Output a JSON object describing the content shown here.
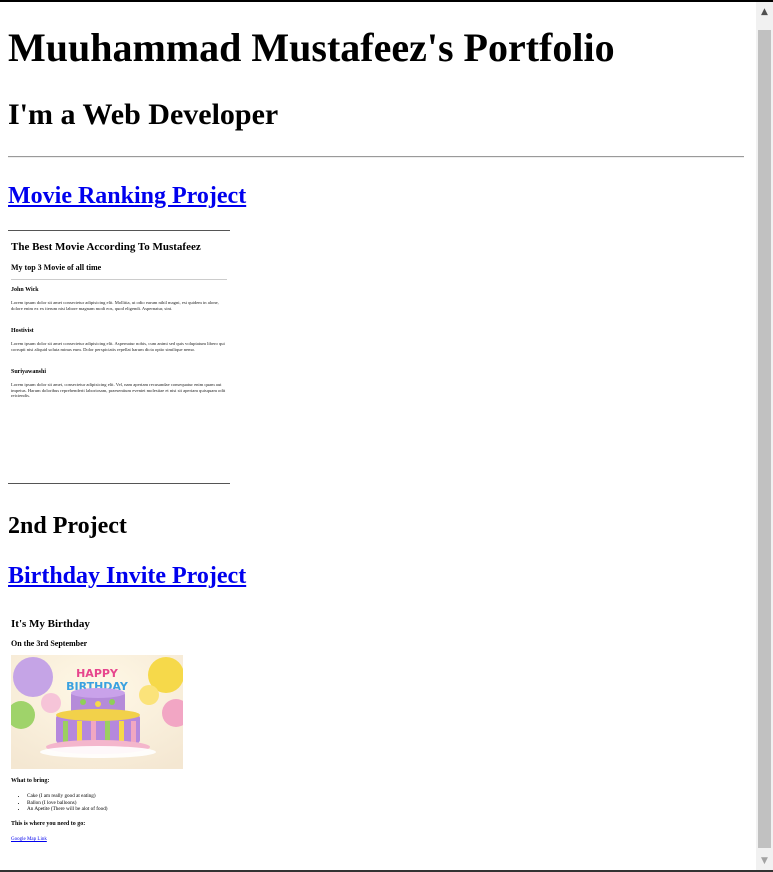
{
  "page": {
    "title": "Muuhammad Mustafeez's Portfolio",
    "subtitle": "I'm a Web Developer"
  },
  "projects": {
    "first_link": "Movie Ranking Project",
    "second_heading": "2nd Project",
    "second_link": "Birthday Invite Project"
  },
  "movie_frame": {
    "title": "The Best Movie According To Mustafeez",
    "subtitle": "My top 3 Movie of all time",
    "movies": [
      {
        "name": "John Wick",
        "text": "Lorem ipsum dolor sit amet consectetur adipisicing elit. Mollitia, ut odio earum nihil magni, est quidem in alone, dolore enim ex ex iterum nisi labore magnam modi eos, quod eligendi. Aspernatur, sint."
      },
      {
        "name": "Hostivist",
        "text": "Lorem ipsum dolor sit amet consectetur adipisicing elit. Aspernatur nobis, cum animi sed quis voluptatum libero qui corrupti nisi aliquid soluta minus eum. Dolor perspiciatis repellat harum dicta optio similique nemo."
      },
      {
        "name": "Suriyawanshi",
        "text": "Lorem ipsum dolor sit amet, consectetur adipisicing elit. Vel, nam aperiam recusandae consequatur enim quam aut impetus. Harum doloribus reprehenderit laboriosam, praesentium eveniet molestiae et nisi sit aperiam quisquam odit reiciendis."
      }
    ]
  },
  "birthday_frame": {
    "title": "It's My Birthday",
    "date": "On the 3rd September",
    "bring_heading": "What to bring:",
    "items": [
      "Cake (I am really good at eating)",
      "Ballon (I love balloons)",
      "An Apetite (There will be alot of food)"
    ],
    "where_heading": "This is where you need to go:",
    "map_link": "Google Map Link",
    "image_text": "HAPPY BIRTHDAY"
  },
  "colors": {
    "link": "#0000ee",
    "scrollbar_track": "#f1f1f1",
    "scrollbar_thumb": "#c1c1c1"
  },
  "icons": {
    "scroll_up": "arrow-up-icon",
    "scroll_down": "arrow-down-icon"
  }
}
